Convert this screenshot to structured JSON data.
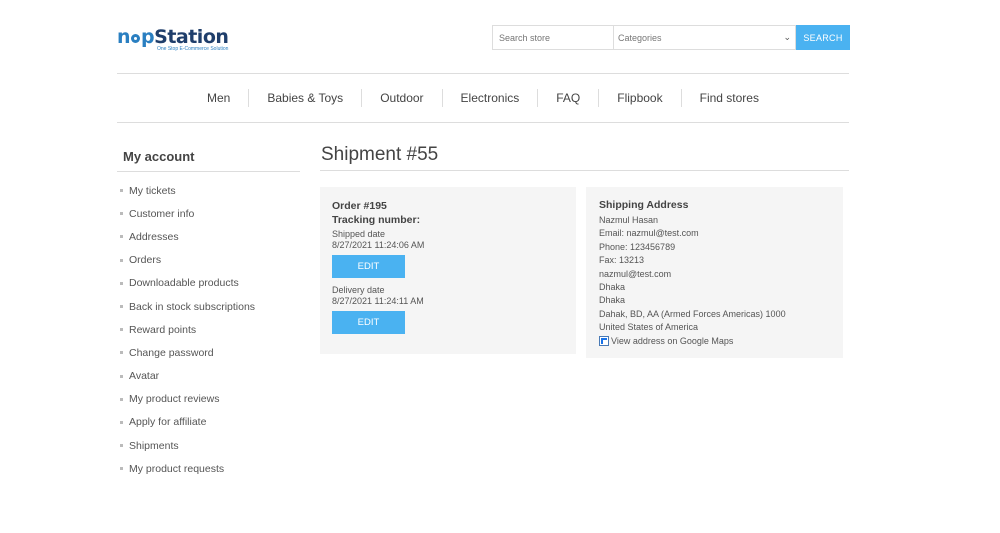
{
  "logo": {
    "part1": "n",
    "part2": "p",
    "part3": "Station",
    "tagline": "One Stop E-Commerce Solution"
  },
  "search": {
    "placeholder": "Search store",
    "category_value": "Categories",
    "button_label": "SEARCH"
  },
  "nav": {
    "items": [
      "Men",
      "Babies & Toys",
      "Outdoor",
      "Electronics",
      "FAQ",
      "Flipbook",
      "Find stores"
    ]
  },
  "sidebar": {
    "title": "My account",
    "items": [
      "My tickets",
      "Customer info",
      "Addresses",
      "Orders",
      "Downloadable products",
      "Back in stock subscriptions",
      "Reward points",
      "Change password",
      "Avatar",
      "My product reviews",
      "Apply for affiliate",
      "Shipments",
      "My product requests"
    ]
  },
  "page": {
    "title": "Shipment #55"
  },
  "shipment": {
    "order": "Order #195",
    "tracking_label": "Tracking number:",
    "shipped_label": "Shipped date",
    "shipped_date": "8/27/2021 11:24:06 AM",
    "edit_label": "EDIT",
    "delivery_label": "Delivery date",
    "delivery_date": "8/27/2021 11:24:11 AM"
  },
  "address": {
    "title": "Shipping Address",
    "lines": [
      "Nazmul Hasan",
      "Email: nazmul@test.com",
      "Phone: 123456789",
      "Fax: 13213",
      "nazmul@test.com",
      "Dhaka",
      "Dhaka",
      "Dahak, BD, AA (Armed Forces Americas) 1000",
      "United States of America"
    ],
    "map_link": "View address on Google Maps"
  },
  "colors": {
    "accent": "#4ab2f1",
    "logo_blue": "#2a7fc1",
    "logo_dark": "#1f3e6b",
    "panel_bg": "#f5f5f5"
  }
}
